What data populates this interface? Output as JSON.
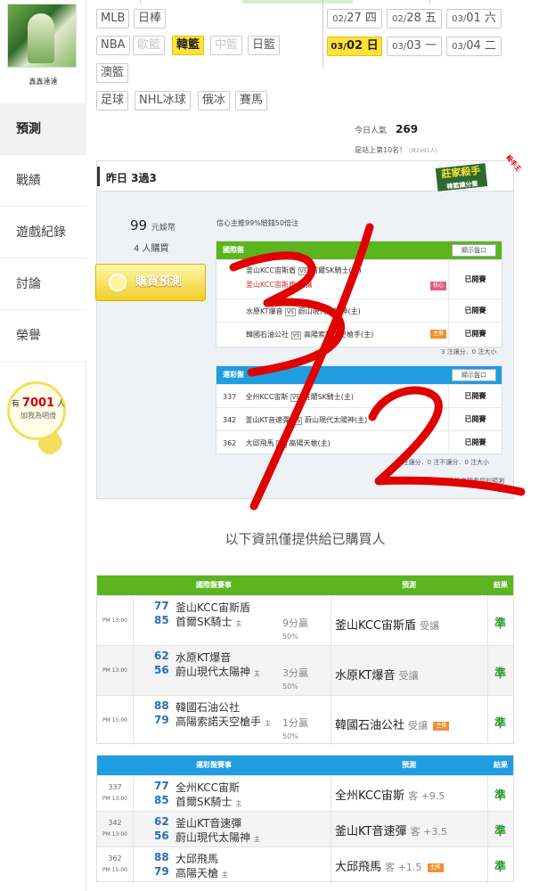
{
  "sidebar": {
    "username": "鑫鑫達達",
    "menu": [
      {
        "label": "預測"
      },
      {
        "label": "戰績"
      },
      {
        "label": "遊戲紀錄"
      },
      {
        "label": "討論"
      },
      {
        "label": "榮譽"
      }
    ],
    "fans_prefix": "有",
    "fans_count": "7001",
    "fans_suffix": "人",
    "fans_cta": "加我為明燈"
  },
  "leagues": {
    "row1": [
      "MLB",
      "日棒"
    ],
    "row2": [
      "NBA",
      "歐籃",
      "韓籃",
      "中籃",
      "日籃"
    ],
    "row3": [
      "澳籃"
    ],
    "row4": [
      "足球",
      "NHL冰球",
      "俄冰",
      "賽馬"
    ]
  },
  "dates": [
    {
      "md": "02/",
      "d": "27",
      "w": "四"
    },
    {
      "md": "02/",
      "d": "28",
      "w": "五"
    },
    {
      "md": "03/",
      "d": "01",
      "w": "六"
    },
    {
      "md": "03/",
      "d": "02",
      "w": "日"
    },
    {
      "md": "03/",
      "d": "03",
      "w": "一"
    },
    {
      "md": "03/",
      "d": "04",
      "w": "二"
    }
  ],
  "popularity": {
    "label": "今日人氣",
    "value": "269",
    "rank_text": "是站上第10名！",
    "rank_note": "(共2491人)"
  },
  "panel": {
    "title": "昨日 3過3",
    "badge_title": "莊家殺手",
    "badge_sub": "韓籃讓分盤",
    "ribbon": "殺手王",
    "price": "99",
    "price_unit": "元娛幣",
    "buyers": "4 人購買",
    "buy_button": "購買預測",
    "confidence": "信心主推99%賠錢50倍注"
  },
  "intl_small": {
    "header": "國際盤",
    "show_button": "顯示盤口",
    "rows": [
      {
        "home": "釜山KCC宙斯盾",
        "away": "首爾SK騎士(主)",
        "pick": "釜山KCC宙斯盾 受讓",
        "tag": "核心",
        "result": "已開賽"
      },
      {
        "home": "水原KT爆音",
        "away": "蔚山現代太陽神(主)",
        "pick": "",
        "tag": "",
        "result": "已開賽"
      },
      {
        "home": "韓國石油公社",
        "away": "高陽索諾天空槍手(主)",
        "pick": "",
        "tag": "主推",
        "result": "已開賽"
      }
    ],
    "footer": "3 注讓分．0 注大小"
  },
  "sport_small": {
    "header": "運彩盤",
    "show_button": "顯示盤口",
    "rows": [
      {
        "no": "337",
        "home": "全州KCC宙斯",
        "away": "首爾SK騎士(主)",
        "result": "已開賽"
      },
      {
        "no": "342",
        "home": "釜山KT音速彈",
        "away": "蔚山現代太陽神(主)",
        "result": "已開賽"
      },
      {
        "no": "362",
        "home": "大邱飛馬",
        "away": "高陽天槍(主)",
        "result": "已開賽"
      }
    ],
    "footer": "3 注讓分．0 注不讓分．0 注大小",
    "note": "今日有購買全盤可用兌換券觀看您的預測"
  },
  "info_title": "以下資訊僅提供給已購買人",
  "intl_table": {
    "headers": [
      "國際盤賽事",
      "預測",
      "結果"
    ],
    "rows": [
      {
        "time": "PM 13:00",
        "s1": "77",
        "s2": "85",
        "t1": "釜山KCC宙斯盾",
        "t2": "首爾SK騎士",
        "home": "主",
        "hc": "9分贏",
        "pct": "50%",
        "pick": "釜山KCC宙斯盾",
        "pick_note": "受讓",
        "tag": "",
        "result": "準"
      },
      {
        "time": "PM 13:00",
        "s1": "62",
        "s2": "56",
        "t1": "水原KT爆音",
        "t2": "蔚山現代太陽神",
        "home": "主",
        "hc": "3分贏",
        "pct": "50%",
        "pick": "水原KT爆音",
        "pick_note": "受讓",
        "tag": "",
        "result": "準"
      },
      {
        "time": "PM 15:00",
        "s1": "88",
        "s2": "79",
        "t1": "韓國石油公社",
        "t2": "高陽索諾天空槍手",
        "home": "主",
        "hc": "1分贏",
        "pct": "50%",
        "pick": "韓國石油公社",
        "pick_note": "受讓",
        "tag": "主推",
        "result": "準"
      }
    ]
  },
  "sport_table": {
    "headers": [
      "運彩盤賽事",
      "預測",
      "結果"
    ],
    "rows": [
      {
        "no": "337",
        "time": "PM 13:00",
        "s1": "77",
        "s2": "85",
        "t1": "全州KCC宙斯",
        "t2": "首爾SK騎士",
        "home": "主",
        "pick": "全州KCC宙斯",
        "pick_note": "客 +9.5",
        "tag": "",
        "result": "準"
      },
      {
        "no": "342",
        "time": "PM 13:00",
        "s1": "62",
        "s2": "56",
        "t1": "釜山KT音速彈",
        "t2": "蔚山現代太陽神",
        "home": "主",
        "pick": "釜山KT音速彈",
        "pick_note": "客 +3.5",
        "tag": "",
        "result": "準"
      },
      {
        "no": "362",
        "time": "PM 15:00",
        "s1": "88",
        "s2": "79",
        "t1": "大邱飛馬",
        "t2": "高陽天槍",
        "home": "主",
        "pick": "大邱飛馬",
        "pick_note": "客 +1.5",
        "tag": "主推",
        "result": "準"
      }
    ]
  },
  "handwriting": "3/2",
  "colors": {
    "green": "#5bb51e",
    "blue": "#1e9ee0",
    "yellow": "#ffe23a",
    "red": "#e00000"
  }
}
